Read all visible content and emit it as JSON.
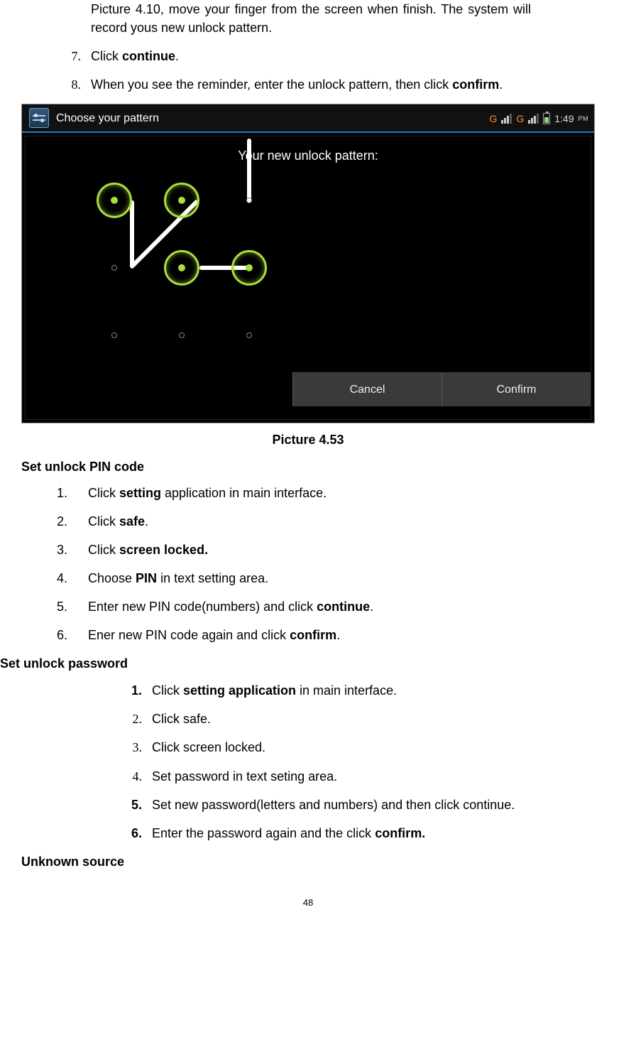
{
  "intro": {
    "line": "Picture 4.10, move your finger from the screen when finish. The system will record yous new unlock pattern."
  },
  "step7": {
    "num": "7.",
    "pre": "Click ",
    "bold": "continue",
    "post": "."
  },
  "step8": {
    "num": "8.",
    "pre": "When you see the reminder, enter the unlock pattern, then click ",
    "bold": "confirm",
    "post": "."
  },
  "figure": {
    "titlebar": "Choose your pattern",
    "heading": "Your new unlock pattern:",
    "cancel": "Cancel",
    "confirm": "Confirm",
    "status": {
      "g": "G",
      "time": "1:49",
      "pm": "PM"
    }
  },
  "caption": "Picture 4.53",
  "pin": {
    "head": "Set unlock PIN code",
    "items": {
      "i1": {
        "num": "1.",
        "pre": "Click ",
        "b": "setting",
        "post": " application in main interface."
      },
      "i2": {
        "num": "2.",
        "pre": "Click ",
        "b": "safe",
        "post": "."
      },
      "i3": {
        "num": "3.",
        "pre": "Click ",
        "b": "screen locked.",
        "post": ""
      },
      "i4": {
        "num": "4.",
        "pre": "Choose ",
        "b": "PIN",
        "post": " in text setting area."
      },
      "i5": {
        "num": "5.",
        "pre": "Enter new PIN code(numbers) and click ",
        "b": "continue",
        "post": "."
      },
      "i6": {
        "num": "6.",
        "pre": "Ener new PIN code again and click ",
        "b": "confirm",
        "post": "."
      }
    }
  },
  "pwd": {
    "head": "Set unlock password",
    "items": {
      "i1": {
        "num": "1.",
        "pre": "Click ",
        "b": "setting application",
        "post": " in main interface."
      },
      "i2": {
        "num": "2.",
        "text": "Click safe."
      },
      "i3": {
        "num": "3.",
        "text": "Click screen locked."
      },
      "i4": {
        "num": "4.",
        "text": "Set password in text seting area."
      },
      "i5": {
        "num": "5.",
        "text": "Set new password(letters and numbers) and then click continue."
      },
      "i6": {
        "num": "6.",
        "pre": "Enter the password again and the click ",
        "b": "confirm.",
        "post": ""
      }
    }
  },
  "unknown": "Unknown source",
  "page": "48"
}
